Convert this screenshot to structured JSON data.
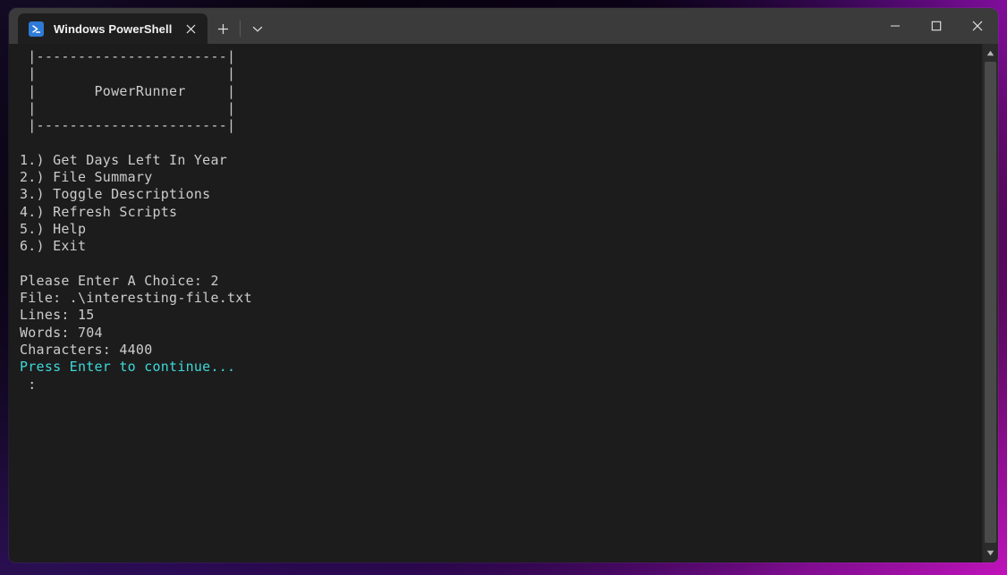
{
  "window": {
    "app_icon": "powershell-icon",
    "tab_title": "Windows PowerShell",
    "close_tab_icon": "close-icon",
    "new_tab_icon": "plus-icon",
    "tab_dropdown_icon": "chevron-down-icon",
    "minimize_icon": "minimize-icon",
    "maximize_icon": "maximize-icon",
    "close_icon": "close-icon"
  },
  "terminal": {
    "banner": {
      "top_border": " |-----------------------|",
      "blank_row_1": " |                       |",
      "title_row": " |       PowerRunner     |",
      "blank_row_2": " |                       |",
      "bottom_border": " |-----------------------|"
    },
    "menu": [
      "1.) Get Days Left In Year",
      "2.) File Summary",
      "3.) Toggle Descriptions",
      "4.) Refresh Scripts",
      "5.) Help",
      "6.) Exit"
    ],
    "output": {
      "prompt_line": "Please Enter A Choice: 2",
      "file_line": "File: .\\interesting-file.txt",
      "lines_line": "Lines: 15",
      "words_line": "Words: 704",
      "characters_line": "Characters: 4400",
      "continue_line": "Press Enter to continue...",
      "cursor_line": " :"
    },
    "colors": {
      "foreground": "#cccccc",
      "background": "#1c1c1c",
      "accent_cyan": "#3fd8d8"
    }
  },
  "scrollbar": {
    "up_arrow_icon": "triangle-up-icon",
    "down_arrow_icon": "triangle-down-icon"
  }
}
